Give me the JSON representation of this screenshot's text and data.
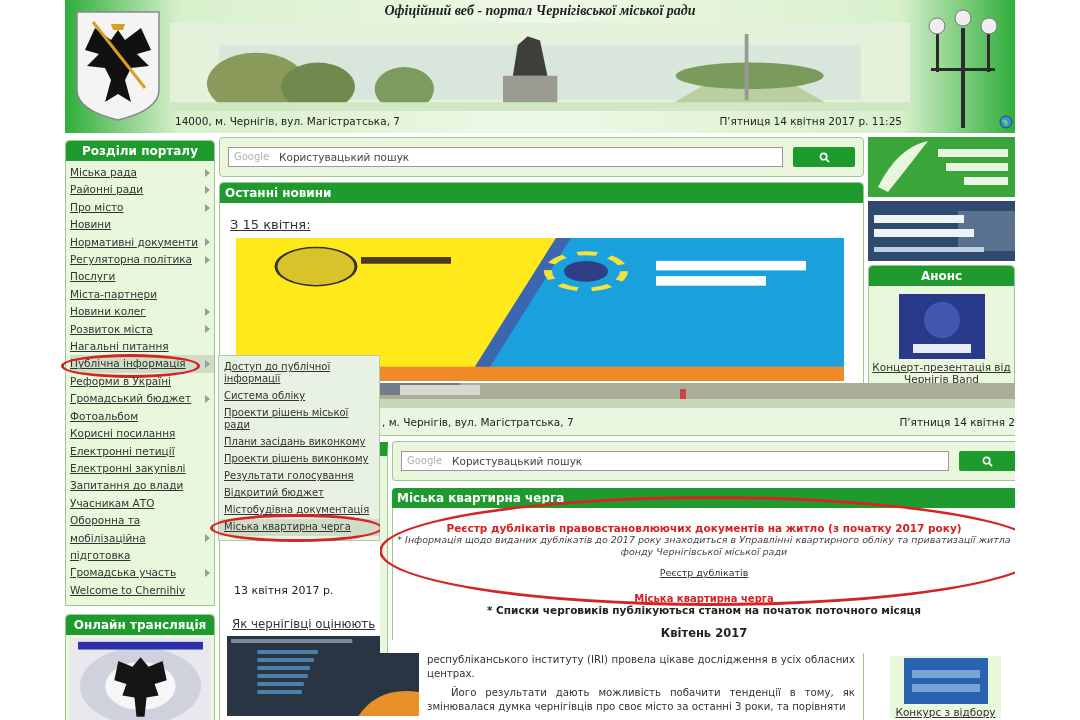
{
  "header": {
    "title": "Офіційний веб - портал Чернігівської міської ради",
    "address": "14000, м. Чернігів, вул. Магістратська, 7",
    "datetime": "П’ятниця 14 квітня 2017 р. 11:25"
  },
  "sidebar": {
    "title": "Розділи порталу",
    "items": [
      {
        "label": "Міська рада",
        "submenu": true,
        "selected": false,
        "circled": false
      },
      {
        "label": "Районні ради",
        "submenu": true,
        "selected": false,
        "circled": false
      },
      {
        "label": "Про місто",
        "submenu": true,
        "selected": false,
        "circled": false
      },
      {
        "label": "Новини",
        "submenu": false,
        "selected": false,
        "circled": false
      },
      {
        "label": "Нормативні документи",
        "submenu": true,
        "selected": false,
        "circled": false
      },
      {
        "label": "Регуляторна політика",
        "submenu": true,
        "selected": false,
        "circled": false
      },
      {
        "label": "Послуги",
        "submenu": false,
        "selected": false,
        "circled": false
      },
      {
        "label": "Міста-партнери",
        "submenu": false,
        "selected": false,
        "circled": false
      },
      {
        "label": "Новини колег",
        "submenu": true,
        "selected": false,
        "circled": false
      },
      {
        "label": "Розвиток міста",
        "submenu": true,
        "selected": false,
        "circled": false
      },
      {
        "label": "Нагальні питання",
        "submenu": false,
        "selected": false,
        "circled": false
      },
      {
        "label": "Публічна інформація",
        "submenu": true,
        "selected": true,
        "circled": true
      },
      {
        "label": "Реформи в Україні",
        "submenu": false,
        "selected": false,
        "circled": false
      },
      {
        "label": "Громадський бюджет",
        "submenu": true,
        "selected": false,
        "circled": false
      },
      {
        "label": "Фотоальбом",
        "submenu": false,
        "selected": false,
        "circled": false
      },
      {
        "label": "Корисні посилання",
        "submenu": false,
        "selected": false,
        "circled": false
      },
      {
        "label": "Електронні петиції",
        "submenu": false,
        "selected": false,
        "circled": false
      },
      {
        "label": "Електронні закупівлі",
        "submenu": false,
        "selected": false,
        "circled": false
      },
      {
        "label": "Запитання до влади",
        "submenu": false,
        "selected": false,
        "circled": false
      },
      {
        "label": "Учасникам АТО",
        "submenu": false,
        "selected": false,
        "circled": false
      },
      {
        "label": "Оборонна та мобілізаційна підготовка",
        "submenu": true,
        "selected": false,
        "circled": false
      },
      {
        "label": "Громадська участь",
        "submenu": true,
        "selected": false,
        "circled": false
      },
      {
        "label": "Welcome to Chernihiv",
        "submenu": false,
        "selected": false,
        "circled": false
      }
    ],
    "live_title": "Онлайн трансляція"
  },
  "submenu": {
    "items": [
      {
        "label": "Доступ до публічної інформації",
        "selected": false,
        "circled": false
      },
      {
        "label": "Система обліку",
        "selected": false,
        "circled": false
      },
      {
        "label": "Проекти рішень міської ради",
        "selected": false,
        "circled": false
      },
      {
        "label": "Плани засідань виконкому",
        "selected": false,
        "circled": false
      },
      {
        "label": "Проекти рішень виконкому",
        "selected": false,
        "circled": false
      },
      {
        "label": "Результати голосування",
        "selected": false,
        "circled": false
      },
      {
        "label": "Відкритий бюджет",
        "selected": false,
        "circled": false
      },
      {
        "label": "Містобудівна документація",
        "selected": false,
        "circled": false
      },
      {
        "label": "Міська квартирна черга",
        "selected": true,
        "circled": true
      }
    ]
  },
  "search": {
    "brand": "Google",
    "placeholder": "Користувацький пошук"
  },
  "news": {
    "title": "Останні новини",
    "first_date": "З 15 квітня:",
    "second_date": "13 квітня 2017 р.",
    "article_title": "Як чернігівці оцінюють",
    "paragraphs": [
      "республіканського інституту (IRI) провела цікаве дослідження в усіх обласних центрах.",
      "Його результати дають можливість побачити тенденції в тому, як змінювалася думка чернігівців про своє місто за останні 3 роки, та порівняти"
    ]
  },
  "right": {
    "anons_title": "Анонс",
    "anons_link": "Концерт-презентація від Чернігів Band",
    "contest_link": "Конкурс з відбору"
  },
  "overlay": {
    "address": ", м. Чернігів, вул. Магістратська, 7",
    "datetime": "П’ятниця 14 квітня 2",
    "search_brand": "Google",
    "search_placeholder": "Користувацький пошук",
    "title": "Міська квартирна черга",
    "notice": {
      "title": "Реєстр дублікатів правовстановлюючих документів на житло (з початку 2017 року)",
      "note": "* Інформація щодо виданих дублікатів до 2017 року знаходиться в Управлінні квартирного обліку та приватизації житла фонду Чернігівської міської ради",
      "link": "Реєстр дублікатів",
      "circled": true
    },
    "subtitle": "Міська квартирна черга",
    "remark": "* Списки черговиків публікуються станом на початок поточного місяця",
    "month": "Квітень 2017"
  }
}
